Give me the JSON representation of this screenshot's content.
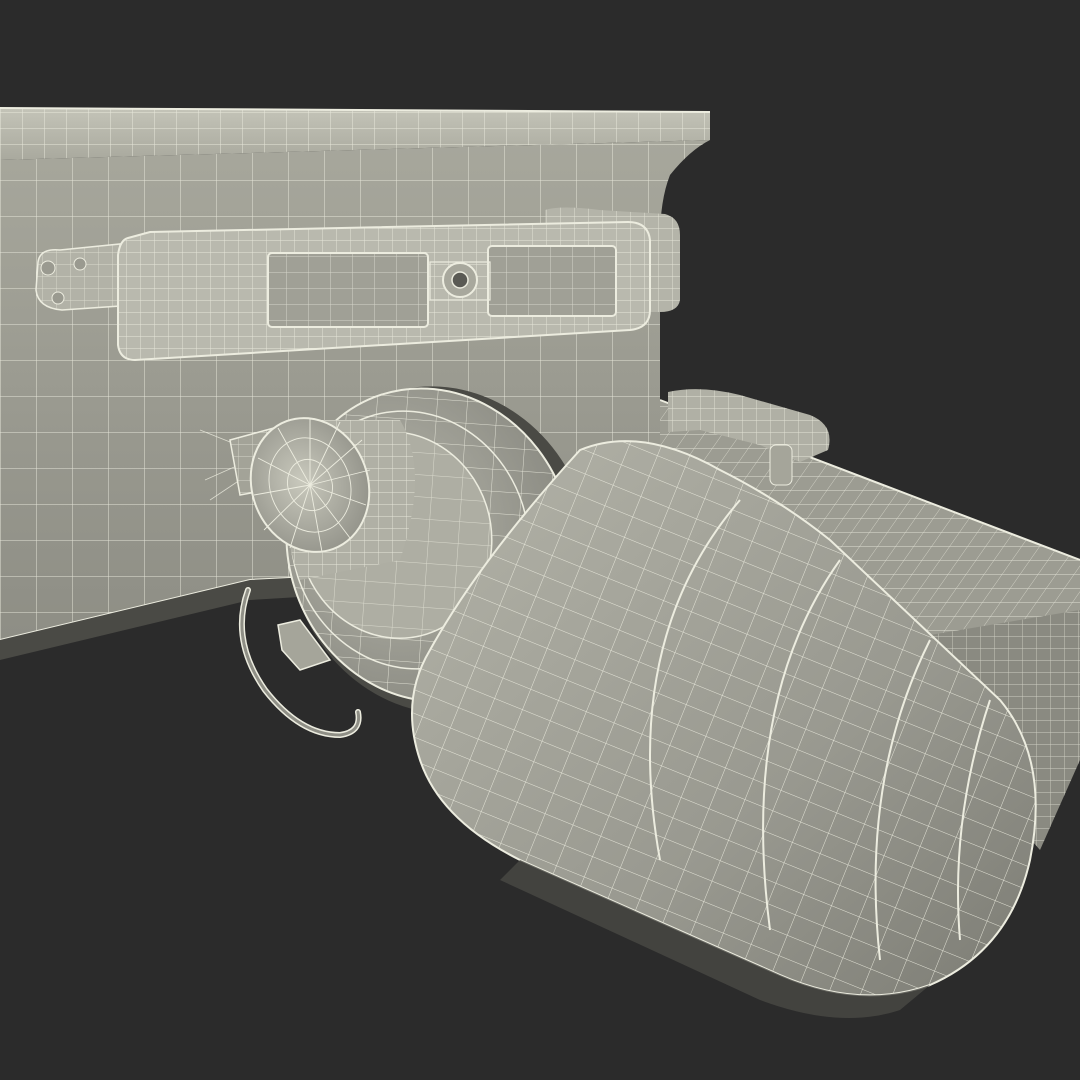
{
  "scene": {
    "description_visible_text": "",
    "colors": {
      "background": "#2b2b2b",
      "surface_light": "#bdbdb2",
      "surface_mid": "#9d9d93",
      "surface_dark": "#6f6f67",
      "shadow": "#4a4a45",
      "wire": "#ececdf"
    },
    "parts": [
      "upper-plate",
      "beam-front-face",
      "pivot-bracket",
      "bolted-strap",
      "side-lug",
      "rear-frame-rail",
      "rear-clip",
      "gladhand-knob",
      "coupler-flange",
      "cable-loop",
      "hose-body"
    ]
  }
}
